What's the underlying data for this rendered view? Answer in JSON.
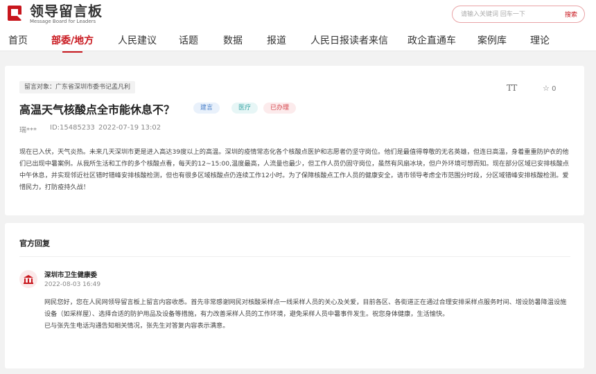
{
  "header": {
    "logo_cn": "领导留言板",
    "logo_en": "Message Board for Leaders",
    "search_placeholder": "请输入关键词 回车一下",
    "search_button": "搜索"
  },
  "nav": {
    "items": [
      {
        "label": "首页"
      },
      {
        "label": "部委/地方",
        "active": true
      },
      {
        "label": "人民建议"
      },
      {
        "label": "话题"
      },
      {
        "label": "数据"
      },
      {
        "label": "报道"
      },
      {
        "label": "人民日报读者来信"
      },
      {
        "label": "政企直通车"
      },
      {
        "label": "案例库"
      },
      {
        "label": "理论"
      }
    ]
  },
  "message": {
    "target": "留言对象：广东省深圳市委书记孟凡利",
    "font_toggle": "TT",
    "star_count": "0",
    "title": "高温天气核酸点全市能休息不？",
    "tags": [
      "建言",
      "医疗",
      "已办理"
    ],
    "author": "瑞***",
    "id": "ID:15485233",
    "date": "2022-07-19 13:02",
    "body": "现在已入伏，天气炎热。未来几天深圳市更是进入高达39度以上的高温。深圳的疫情常态化各个核酸点医护和志愿者仍坚守岗位。他们是最值得尊敬的无名英雄，但连日高温，身着重重防护衣的他们已出现中暑案例。从我所生活和工作的多个核酸点看，每天的12~15:00,温度最高，人流量也最少，但工作人员仍固守岗位，虽然有风扇冰块，但户外环境可想而知。现在部分区域已安排核酸点中午休息，并实现邻近社区错时错峰安排核酸检测，但也有很多区域核酸点仍连续工作12小时。为了保障核酸点工作人员的健康安全，请市领导考虑全市范围分时段，分区域错峰安排核酸检测。爱惜民力，打防疫持久战！"
  },
  "reply": {
    "section_title": "官方回复",
    "replier": "深圳市卫生健康委",
    "time": "2022-08-03 16:49",
    "body_1": "网民您好，您在人民网领导留言板上留言内容收悉。首先非常感谢网民对核酸采样点一线采样人员的关心及关爱，目前各区、各街道正在通过合理安排采样点服务时间、增设防暑降温设施设备（如采样屋）、选择合适的防护用品及设备等措施，有力改善采样人员的工作环境，避免采样人员中暑事件发生。祝您身体健康，生活愉快。",
    "body_2": "已与张先生电话沟通告知相关情况，张先生对答复内容表示满意。"
  },
  "colors": {
    "brand_red": "#c8161d",
    "tag_blue": "#4a80c9",
    "tag_teal": "#3aa5a5",
    "tag_red": "#d4454c"
  }
}
